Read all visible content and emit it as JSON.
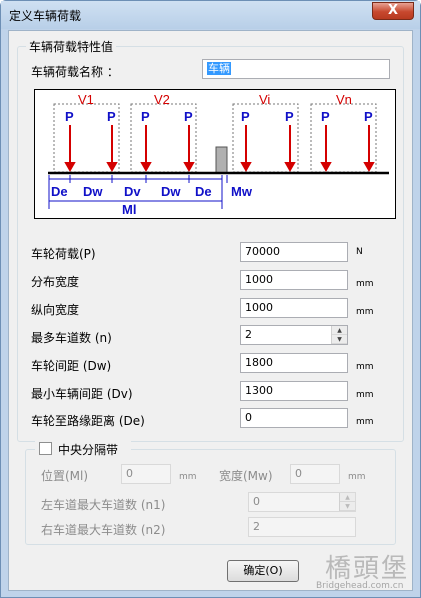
{
  "window": {
    "title": "定义车辆荷载",
    "close_label": "X"
  },
  "section": {
    "title": "车辆荷载特性值",
    "name_label": "车辆荷载名称 ：",
    "name_value": "车辆"
  },
  "diagram": {
    "groups": [
      "V1",
      "V2",
      "Vi",
      "Vn"
    ],
    "load_label": "P",
    "dims": [
      "De",
      "Dw",
      "Dv",
      "Dw",
      "De",
      "Mw",
      "Ml"
    ],
    "colors": {
      "load": "#d40000",
      "text": "#1010c8"
    }
  },
  "fields": [
    {
      "label": "车轮荷载(P)",
      "value": "70000",
      "unit": "N"
    },
    {
      "label": "分布宽度",
      "value": "1000",
      "unit": "mm"
    },
    {
      "label": "纵向宽度",
      "value": "1000",
      "unit": "mm"
    },
    {
      "label": "最多车道数 (n)",
      "value": "2",
      "unit": ""
    },
    {
      "label": "车轮间距 (Dw)",
      "value": "1800",
      "unit": "mm"
    },
    {
      "label": "最小车辆间距 (Dv)",
      "value": "1300",
      "unit": "mm"
    },
    {
      "label": "车轮至路缘距离 (De)",
      "value": "0",
      "unit": "mm"
    }
  ],
  "median": {
    "checkbox_label": "中央分隔带",
    "position_label": "位置(Ml)",
    "position_value": "0",
    "position_unit": "mm",
    "width_label": "宽度(Mw)",
    "width_value": "0",
    "width_unit": "mm",
    "left_label": "左车道最大车道数 (n1)",
    "left_value": "0",
    "right_label": "右车道最大车道数 (n2)",
    "right_value": "2"
  },
  "buttons": {
    "ok": "确定(O)"
  },
  "watermark": {
    "logo": "橋頭堡",
    "url": "Bridgehead.com.cn"
  }
}
